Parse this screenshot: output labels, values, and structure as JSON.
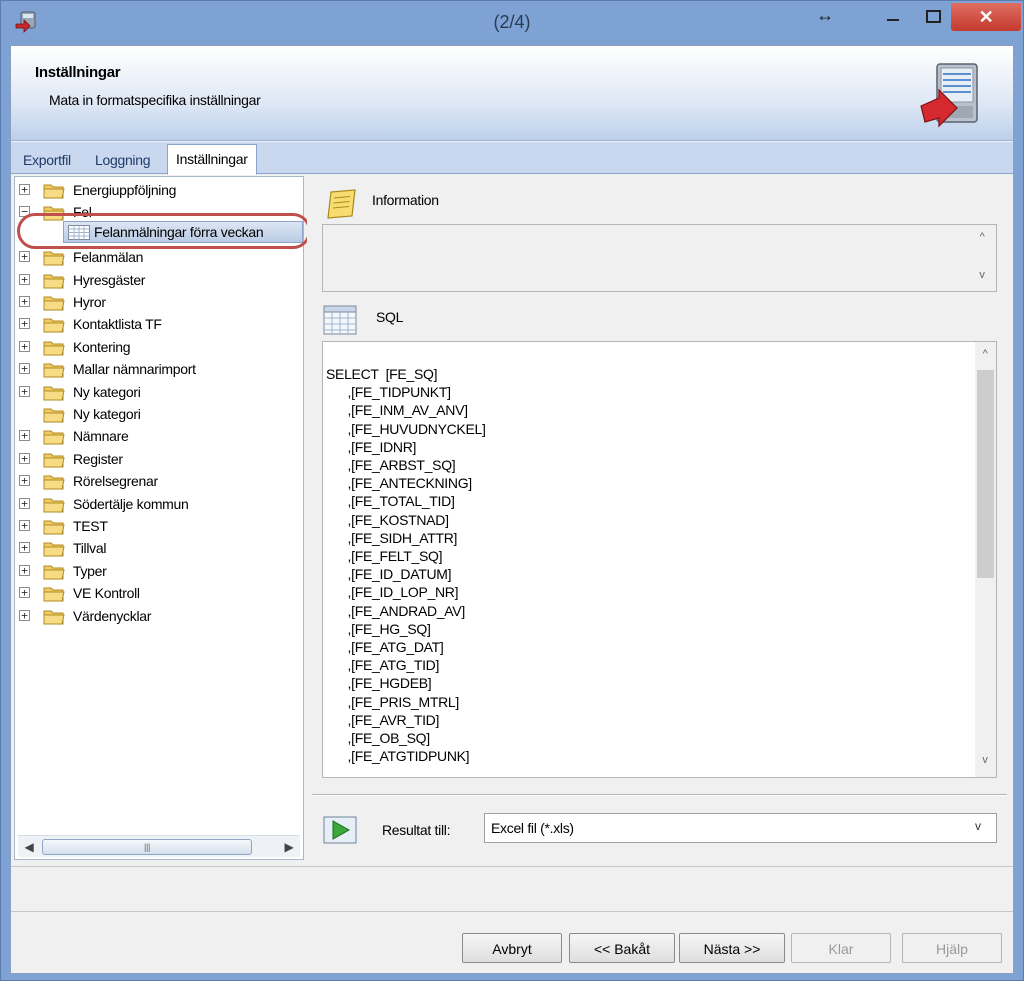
{
  "window": {
    "title": "(2/4)",
    "resize_glyph": "↔",
    "close_glyph": "✕"
  },
  "header": {
    "title": "Inställningar",
    "subtitle": "Mata in formatspecifika inställningar"
  },
  "tabs": [
    {
      "label": "Exportfil"
    },
    {
      "label": "Loggning"
    },
    {
      "label": "Inställningar",
      "active": true
    }
  ],
  "tree": {
    "items": [
      {
        "label": "Energiuppföljning",
        "expander": "+"
      },
      {
        "label": "Fel",
        "expander": "−",
        "expanded": true
      },
      {
        "label": "Felanmälan",
        "expander": "+"
      },
      {
        "label": "Hyresgäster",
        "expander": "+"
      },
      {
        "label": "Hyror",
        "expander": "+"
      },
      {
        "label": "Kontaktlista TF",
        "expander": "+"
      },
      {
        "label": "Kontering",
        "expander": "+"
      },
      {
        "label": "Mallar nämnarimport",
        "expander": "+"
      },
      {
        "label": "Ny kategori",
        "expander": "+"
      },
      {
        "label": "Ny kategori",
        "expander": ""
      },
      {
        "label": "Nämnare",
        "expander": "+"
      },
      {
        "label": "Register",
        "expander": "+"
      },
      {
        "label": "Rörelsegrenar",
        "expander": "+"
      },
      {
        "label": "Södertälje kommun",
        "expander": "+"
      },
      {
        "label": "TEST",
        "expander": "+"
      },
      {
        "label": "Tillval",
        "expander": "+"
      },
      {
        "label": "Typer",
        "expander": "+"
      },
      {
        "label": "VE Kontroll",
        "expander": "+"
      },
      {
        "label": "Värdenycklar",
        "expander": "+"
      }
    ],
    "selected_child": {
      "label": "Felanmälningar förra veckan"
    },
    "hscroll_grip": "|||",
    "arrow_left": "◀",
    "arrow_right": "▶"
  },
  "info": {
    "label": "Information",
    "text": ""
  },
  "sql": {
    "label": "SQL",
    "text": "SELECT  [FE_SQ]\n      ,[FE_TIDPUNKT]\n      ,[FE_INM_AV_ANV]\n      ,[FE_HUVUDNYCKEL]\n      ,[FE_IDNR]\n      ,[FE_ARBST_SQ]\n      ,[FE_ANTECKNING]\n      ,[FE_TOTAL_TID]\n      ,[FE_KOSTNAD]\n      ,[FE_SIDH_ATTR]\n      ,[FE_FELT_SQ]\n      ,[FE_ID_DATUM]\n      ,[FE_ID_LOP_NR]\n      ,[FE_ANDRAD_AV]\n      ,[FE_HG_SQ]\n      ,[FE_ATG_DAT]\n      ,[FE_ATG_TID]\n      ,[FE_HGDEB]\n      ,[FE_PRIS_MTRL]\n      ,[FE_AVR_TID]\n      ,[FE_OB_SQ]\n      ,[FE_ATGTIDPUNK]"
  },
  "result": {
    "label": "Resultat till:",
    "value": "Excel fil (*.xls)"
  },
  "scroll_glyphs": {
    "up": "^",
    "down": "v"
  },
  "buttons": {
    "cancel": "Avbryt",
    "back": "<< Bakåt",
    "next": "Nästa >>",
    "finish": "Klar",
    "help": "Hjälp"
  },
  "colors": {
    "accent": "#7fa2d4",
    "selection_oval": "#c0504d",
    "close_button": "#c4392d"
  }
}
